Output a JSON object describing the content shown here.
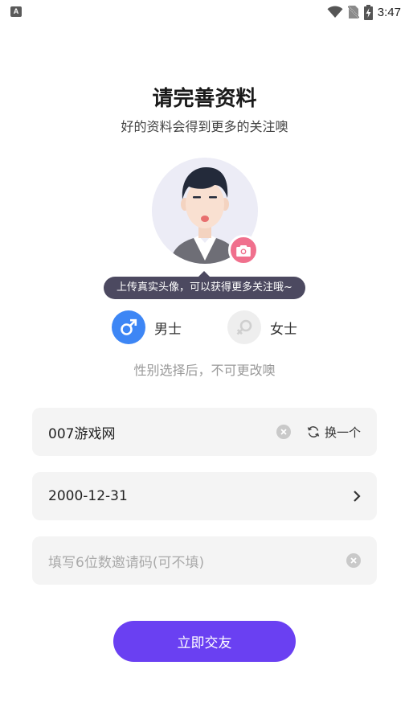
{
  "status_bar": {
    "notification_icon_letter": "A",
    "time": "3:47"
  },
  "header": {
    "title": "请完善资料",
    "subtitle": "好的资料会得到更多的关注噢"
  },
  "avatar": {
    "tooltip": "上传真实头像，可以获得更多关注哦~"
  },
  "gender": {
    "male_label": "男士",
    "female_label": "女士",
    "selected": "male",
    "note": "性别选择后，不可更改噢"
  },
  "form": {
    "nickname_value": "007游戏网",
    "refresh_label": "换一个",
    "birthday_value": "2000-12-31",
    "invite_placeholder": "填写6位数邀请码(可不填)"
  },
  "submit_label": "立即交友",
  "colors": {
    "accent": "#6a40f2",
    "male": "#3d86f5",
    "camera": "#f0708d",
    "tooltip_bg": "#4c4960"
  },
  "icons": [
    "notification-icon",
    "wifi-icon",
    "no-sim-icon",
    "battery-charging-icon",
    "camera-icon",
    "male-icon",
    "female-icon",
    "clear-icon",
    "refresh-icon",
    "chevron-right-icon"
  ]
}
